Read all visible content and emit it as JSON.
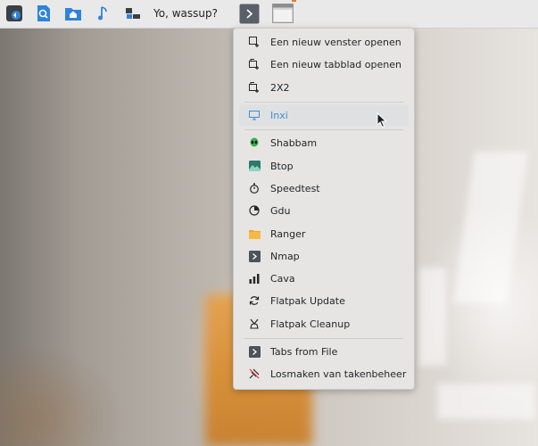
{
  "taskbar": {
    "title": "Yo, wassup?",
    "icons": [
      "terminal-app-icon",
      "document-viewer-icon",
      "home-folder-icon",
      "music-icon",
      "network-icon",
      "terminal-task-icon",
      "window-thumbnail-icon"
    ]
  },
  "menu": {
    "items": [
      {
        "label": "Een nieuw venster openen",
        "icon": "new-window-icon"
      },
      {
        "label": "Een nieuw tabblad openen",
        "icon": "new-tab-icon"
      },
      {
        "label": "2X2",
        "icon": "new-tab-icon"
      },
      {
        "label": "Inxi",
        "icon": "monitor-icon",
        "highlighted": true
      },
      {
        "label": "Shabbam",
        "icon": "alien-icon"
      },
      {
        "label": "Btop",
        "icon": "image-icon"
      },
      {
        "label": "Speedtest",
        "icon": "stopwatch-icon"
      },
      {
        "label": "Gdu",
        "icon": "pie-chart-icon"
      },
      {
        "label": "Ranger",
        "icon": "folder-icon"
      },
      {
        "label": "Nmap",
        "icon": "terminal-icon"
      },
      {
        "label": "Cava",
        "icon": "bar-chart-icon"
      },
      {
        "label": "Flatpak Update",
        "icon": "refresh-icon"
      },
      {
        "label": "Flatpak Cleanup",
        "icon": "broom-icon"
      },
      {
        "label": "Tabs from File",
        "icon": "terminal-icon"
      },
      {
        "label": "Losmaken van takenbeheer",
        "icon": "unpin-icon"
      }
    ]
  },
  "colors": {
    "highlight_text": "#3a8fd6",
    "menu_bg": "#e6e5e4",
    "taskbar_bg": "#e9e9ea"
  }
}
